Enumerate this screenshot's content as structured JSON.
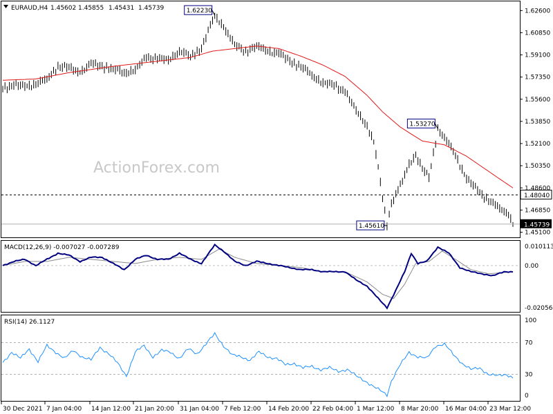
{
  "header": {
    "symbol": "EURAUD,H4",
    "open": "1.45602",
    "high": "1.45855",
    "low": "1.45431",
    "close": "1.45739"
  },
  "watermark": "ActionForex.com",
  "macd_title": "MACD(12,26,9) -0.007027 -0.007289",
  "rsi_title": "RSI(14) 26.1127",
  "colors": {
    "price": "#000000",
    "sma": "#e01818",
    "macd": "#000080",
    "signal": "#8a8a8a",
    "rsi": "#1e90ff",
    "label_border": "#000080"
  },
  "chart_data": [
    {
      "type": "line",
      "title": "EURAUD,H4",
      "x_tick_labels": [
        "30 Dec 2021",
        "7 Jan 04:00",
        "14 Jan 12:00",
        "21 Jan 20:00",
        "31 Jan 04:00",
        "7 Feb 12:00",
        "14 Feb 20:00",
        "22 Feb 04:00",
        "1 Mar 12:00",
        "8 Mar 20:00",
        "16 Mar 04:00",
        "23 Mar 12:00"
      ],
      "y_ticks": [
        "1.62600",
        "1.60850",
        "1.59100",
        "1.57350",
        "1.55600",
        "1.53850",
        "1.52100",
        "1.50350",
        "1.48600",
        "1.46850",
        "1.45100"
      ],
      "ylim": [
        1.448,
        1.63
      ],
      "levels": [
        {
          "label": "1.48040",
          "value": 1.4804,
          "style": "dashed"
        },
        {
          "label": "1.45739",
          "value": 1.45739,
          "style": "current"
        }
      ],
      "annotations": [
        {
          "label": "1.62230",
          "value": 1.6223,
          "x_index": 96
        },
        {
          "label": "1.53270",
          "value": 1.5327,
          "x_index": 197
        },
        {
          "label": "1.45610",
          "value": 1.4561,
          "x_index": 174
        }
      ],
      "series": [
        {
          "name": "EURAUD",
          "values": [
            [
              0,
              1.565
            ],
            [
              5,
              1.567
            ],
            [
              10,
              1.566
            ],
            [
              15,
              1.568
            ],
            [
              20,
              1.572
            ],
            [
              25,
              1.582
            ],
            [
              30,
              1.581
            ],
            [
              35,
              1.577
            ],
            [
              40,
              1.584
            ],
            [
              45,
              1.582
            ],
            [
              50,
              1.58
            ],
            [
              55,
              1.577
            ],
            [
              60,
              1.579
            ],
            [
              65,
              1.589
            ],
            [
              70,
              1.588
            ],
            [
              75,
              1.587
            ],
            [
              80,
              1.594
            ],
            [
              85,
              1.59
            ],
            [
              90,
              1.596
            ],
            [
              93,
              1.61
            ],
            [
              96,
              1.6223
            ],
            [
              100,
              1.613
            ],
            [
              105,
              1.599
            ],
            [
              110,
              1.594
            ],
            [
              115,
              1.598
            ],
            [
              120,
              1.594
            ],
            [
              125,
              1.592
            ],
            [
              130,
              1.586
            ],
            [
              135,
              1.582
            ],
            [
              140,
              1.575
            ],
            [
              145,
              1.569
            ],
            [
              150,
              1.567
            ],
            [
              155,
              1.562
            ],
            [
              160,
              1.547
            ],
            [
              165,
              1.535
            ],
            [
              168,
              1.522
            ],
            [
              170,
              1.503
            ],
            [
              172,
              1.478
            ],
            [
              174,
              1.4561
            ],
            [
              176,
              1.474
            ],
            [
              178,
              1.481
            ],
            [
              181,
              1.492
            ],
            [
              184,
              1.505
            ],
            [
              187,
              1.512
            ],
            [
              190,
              1.501
            ],
            [
              193,
              1.494
            ],
            [
              197,
              1.5327
            ],
            [
              200,
              1.526
            ],
            [
              205,
              1.512
            ],
            [
              210,
              1.493
            ],
            [
              215,
              1.484
            ],
            [
              220,
              1.476
            ],
            [
              225,
              1.47
            ],
            [
              229,
              1.465
            ],
            [
              231,
              1.45739
            ]
          ]
        },
        {
          "name": "SMA",
          "values": [
            [
              0,
              1.571
            ],
            [
              15,
              1.572
            ],
            [
              30,
              1.577
            ],
            [
              50,
              1.582
            ],
            [
              70,
              1.586
            ],
            [
              85,
              1.589
            ],
            [
              95,
              1.594
            ],
            [
              105,
              1.596
            ],
            [
              115,
              1.598
            ],
            [
              125,
              1.596
            ],
            [
              135,
              1.59
            ],
            [
              145,
              1.583
            ],
            [
              155,
              1.574
            ],
            [
              165,
              1.559
            ],
            [
              172,
              1.546
            ],
            [
              180,
              1.534
            ],
            [
              190,
              1.523
            ],
            [
              200,
              1.52
            ],
            [
              210,
              1.511
            ],
            [
              220,
              1.499
            ],
            [
              231,
              1.486
            ]
          ]
        }
      ]
    },
    {
      "type": "line",
      "title": "MACD(12,26,9) -0.007027 -0.007289",
      "y_ticks": [
        "0.010113",
        "0.00",
        "-0.020561"
      ],
      "ylim": [
        -0.0225,
        0.011
      ],
      "series": [
        {
          "name": "MACD",
          "values": [
            [
              0,
              0.0
            ],
            [
              5,
              0.002
            ],
            [
              10,
              0.003
            ],
            [
              15,
              0.0
            ],
            [
              20,
              0.003
            ],
            [
              25,
              0.006
            ],
            [
              30,
              0.005
            ],
            [
              35,
              0.002
            ],
            [
              40,
              0.004
            ],
            [
              45,
              0.004
            ],
            [
              50,
              0.001
            ],
            [
              55,
              -0.002
            ],
            [
              60,
              0.003
            ],
            [
              65,
              0.005
            ],
            [
              70,
              0.003
            ],
            [
              75,
              0.003
            ],
            [
              80,
              0.006
            ],
            [
              85,
              0.003
            ],
            [
              90,
              0.001
            ],
            [
              96,
              0.01
            ],
            [
              100,
              0.007
            ],
            [
              105,
              0.002
            ],
            [
              110,
              0.0
            ],
            [
              115,
              0.002
            ],
            [
              120,
              0.001
            ],
            [
              125,
              0.0
            ],
            [
              130,
              -0.001
            ],
            [
              135,
              -0.002
            ],
            [
              140,
              -0.002
            ],
            [
              145,
              -0.003
            ],
            [
              150,
              -0.003
            ],
            [
              155,
              -0.003
            ],
            [
              160,
              -0.007
            ],
            [
              165,
              -0.01
            ],
            [
              170,
              -0.016
            ],
            [
              174,
              -0.0205
            ],
            [
              178,
              -0.012
            ],
            [
              182,
              -0.003
            ],
            [
              185,
              0.006
            ],
            [
              188,
              0.001
            ],
            [
              192,
              0.002
            ],
            [
              197,
              0.009
            ],
            [
              202,
              0.006
            ],
            [
              207,
              -0.001
            ],
            [
              212,
              -0.003
            ],
            [
              217,
              -0.004
            ],
            [
              222,
              -0.005
            ],
            [
              227,
              -0.003
            ],
            [
              231,
              -0.003
            ]
          ]
        },
        {
          "name": "Signal",
          "values": [
            [
              0,
              0.0
            ],
            [
              10,
              0.002
            ],
            [
              20,
              0.002
            ],
            [
              30,
              0.004
            ],
            [
              40,
              0.003
            ],
            [
              50,
              0.002
            ],
            [
              60,
              0.001
            ],
            [
              70,
              0.003
            ],
            [
              80,
              0.004
            ],
            [
              90,
              0.003
            ],
            [
              98,
              0.008
            ],
            [
              105,
              0.004
            ],
            [
              115,
              0.001
            ],
            [
              125,
              0.0
            ],
            [
              135,
              -0.001
            ],
            [
              145,
              -0.003
            ],
            [
              155,
              -0.003
            ],
            [
              165,
              -0.008
            ],
            [
              172,
              -0.014
            ],
            [
              177,
              -0.016
            ],
            [
              182,
              -0.009
            ],
            [
              187,
              0.001
            ],
            [
              193,
              0.002
            ],
            [
              199,
              0.007
            ],
            [
              205,
              0.003
            ],
            [
              212,
              -0.002
            ],
            [
              220,
              -0.004
            ],
            [
              231,
              -0.003
            ]
          ]
        }
      ]
    },
    {
      "type": "line",
      "title": "RSI(14) 26.1127",
      "y_ticks": [
        "100",
        "70",
        "30",
        "0"
      ],
      "ylim": [
        0,
        100
      ],
      "levels": [
        70,
        30
      ],
      "series": [
        {
          "name": "RSI",
          "values": [
            [
              0,
              45
            ],
            [
              4,
              58
            ],
            [
              8,
              50
            ],
            [
              12,
              62
            ],
            [
              16,
              46
            ],
            [
              20,
              66
            ],
            [
              24,
              58
            ],
            [
              28,
              50
            ],
            [
              32,
              60
            ],
            [
              36,
              52
            ],
            [
              40,
              48
            ],
            [
              44,
              64
            ],
            [
              48,
              56
            ],
            [
              52,
              44
            ],
            [
              56,
              28
            ],
            [
              60,
              58
            ],
            [
              64,
              66
            ],
            [
              68,
              52
            ],
            [
              72,
              60
            ],
            [
              76,
              58
            ],
            [
              80,
              50
            ],
            [
              84,
              62
            ],
            [
              88,
              56
            ],
            [
              92,
              68
            ],
            [
              96,
              81
            ],
            [
              100,
              66
            ],
            [
              104,
              54
            ],
            [
              108,
              52
            ],
            [
              112,
              48
            ],
            [
              116,
              58
            ],
            [
              120,
              52
            ],
            [
              124,
              50
            ],
            [
              128,
              42
            ],
            [
              132,
              44
            ],
            [
              136,
              38
            ],
            [
              140,
              40
            ],
            [
              144,
              36
            ],
            [
              148,
              38
            ],
            [
              152,
              34
            ],
            [
              156,
              36
            ],
            [
              160,
              28
            ],
            [
              164,
              22
            ],
            [
              168,
              14
            ],
            [
              172,
              8
            ],
            [
              174,
              4
            ],
            [
              176,
              22
            ],
            [
              180,
              42
            ],
            [
              184,
              58
            ],
            [
              188,
              52
            ],
            [
              192,
              50
            ],
            [
              196,
              66
            ],
            [
              200,
              68
            ],
            [
              204,
              55
            ],
            [
              208,
              44
            ],
            [
              212,
              36
            ],
            [
              216,
              38
            ],
            [
              220,
              30
            ],
            [
              224,
              28
            ],
            [
              228,
              30
            ],
            [
              231,
              26
            ]
          ]
        }
      ]
    }
  ]
}
